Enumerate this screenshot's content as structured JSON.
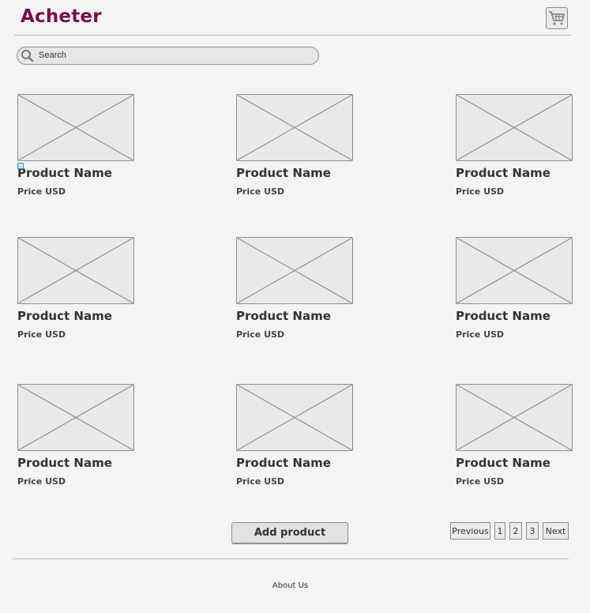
{
  "header": {
    "logo_text": "Acheter",
    "cart_icon": "shopping-cart-icon"
  },
  "search": {
    "placeholder": "Search",
    "icon": "search-icon"
  },
  "products": [
    {
      "name": "Product Name",
      "price": "Price USD"
    },
    {
      "name": "Product Name",
      "price": "Price USD"
    },
    {
      "name": "Product Name",
      "price": "Price USD"
    },
    {
      "name": "Product Name",
      "price": "Price USD"
    },
    {
      "name": "Product Name",
      "price": "Price USD"
    },
    {
      "name": "Product Name",
      "price": "Price USD"
    },
    {
      "name": "Product Name",
      "price": "Price USD"
    },
    {
      "name": "Product Name",
      "price": "Price USD"
    },
    {
      "name": "Product Name",
      "price": "Price USD"
    }
  ],
  "actions": {
    "add_product_label": "Add product"
  },
  "pagination": {
    "previous_label": "Previous",
    "pages": [
      "1",
      "2",
      "3"
    ],
    "next_label": "Next"
  },
  "footer": {
    "about_label": "About Us"
  },
  "colors": {
    "brand": "#7a0c45",
    "background": "#f4f4f4",
    "placeholder_fill": "#e9e9e9",
    "border": "#8e8e8e"
  }
}
